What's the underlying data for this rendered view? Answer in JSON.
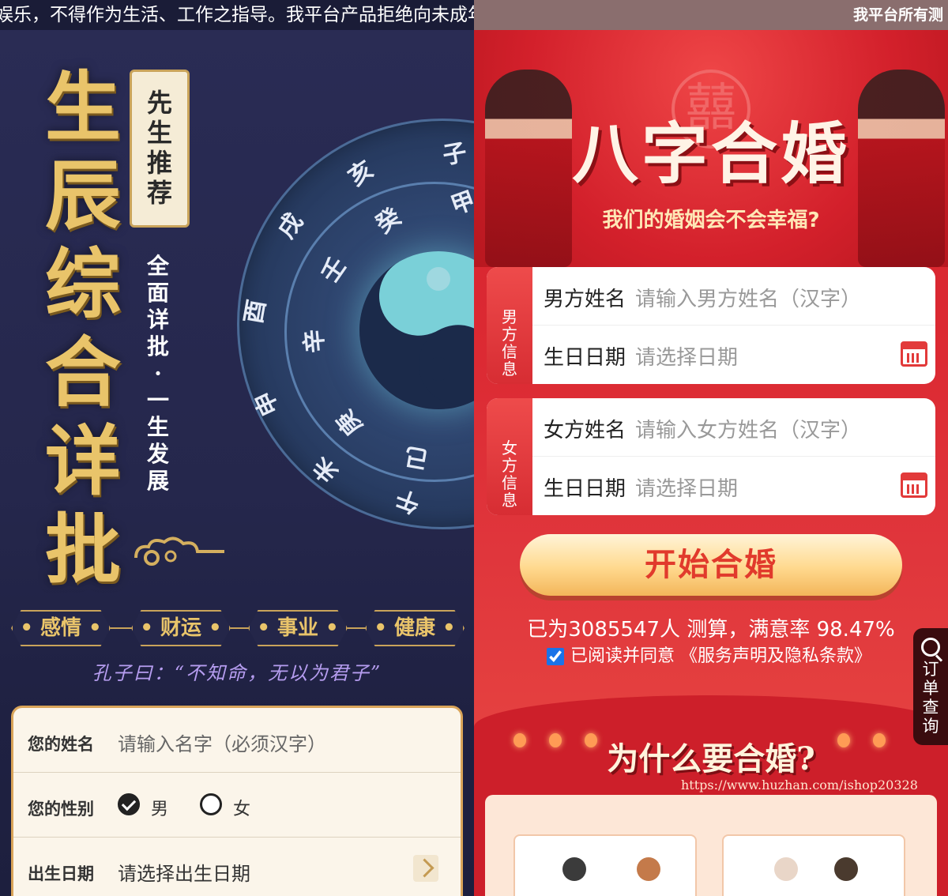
{
  "left": {
    "marquee": "娱乐，不得作为生活、工作之指导。我平台产品拒绝向未成年",
    "title_chars": [
      "生",
      "辰",
      "综",
      "合",
      "详",
      "批"
    ],
    "scroll_chars": [
      "先",
      "生",
      "推",
      "荐"
    ],
    "subtitle_chars": [
      "全",
      "面",
      "详",
      "批",
      "·",
      "一",
      "生",
      "发",
      "展"
    ],
    "wheel_runes": [
      "亥",
      "子",
      "甲",
      "戌",
      "癸",
      "壬",
      "酉",
      "辛",
      "申",
      "庚",
      "未",
      "己",
      "午"
    ],
    "tags": [
      "• 感情 •",
      "• 财运 •",
      "• 事业 •",
      "• 健康 •"
    ],
    "quote": "孔子曰：“不知命，无以为君子”",
    "form": {
      "name_label": "您的姓名",
      "name_placeholder": "请输入名字（必须汉字）",
      "gender_label": "您的性别",
      "gender_male": "男",
      "gender_female": "女",
      "gender_selected": "男",
      "birth_label": "出生日期",
      "birth_placeholder": "请选择出生日期"
    }
  },
  "right": {
    "marquee": "我平台所有测",
    "banner_symbol": "囍",
    "title": "八字合婚",
    "tagline": "我们的婚姻会不会幸福?",
    "male_card": {
      "side": [
        "男",
        "方",
        "信",
        "息"
      ],
      "name_label": "男方姓名",
      "name_placeholder": "请输入男方姓名（汉字）",
      "date_label": "生日日期",
      "date_placeholder": "请选择日期"
    },
    "female_card": {
      "side": [
        "女",
        "方",
        "信",
        "息"
      ],
      "name_label": "女方姓名",
      "name_placeholder": "请输入女方姓名（汉字）",
      "date_label": "生日日期",
      "date_placeholder": "请选择日期"
    },
    "start_button": "开始合婚",
    "stat": "已为3085547人 测算，满意率 98.47%",
    "agree_text": "已阅读并同意 《服务声明及隐私条款》",
    "agree_checked": true,
    "section_title": "为什么要合婚?",
    "watermark_url": "https://www.huzhan.com/ishop20328",
    "side_tab": [
      "订",
      "单",
      "查",
      "询"
    ]
  },
  "colors": {
    "gold": "#e9c46a",
    "navy": "#25274c",
    "red": "#d3202b",
    "button_text": "#e13a2c"
  }
}
